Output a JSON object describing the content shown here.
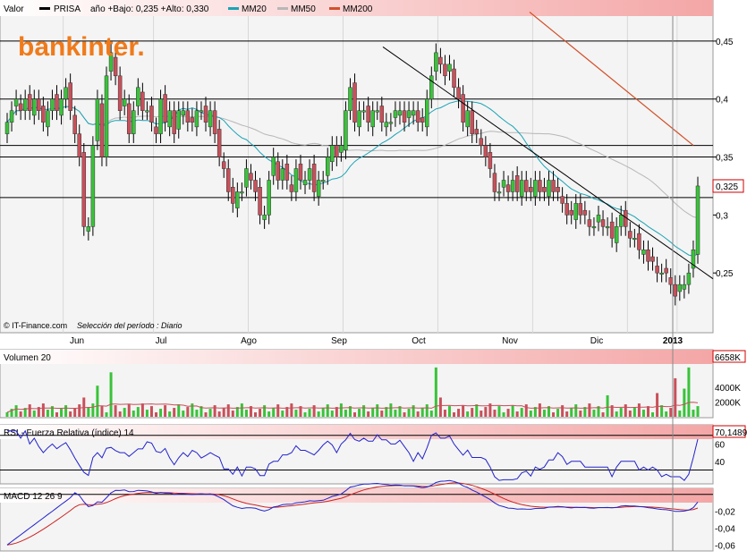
{
  "header": {
    "valor_label": "Valor",
    "ticker": "PRISA",
    "stats": "año +Bajo: 0,235 +Alto: 0,330",
    "legend": [
      {
        "name": "MM20",
        "color": "#1aa3b5"
      },
      {
        "name": "MM50",
        "color": "#b7b7b7"
      },
      {
        "name": "MM200",
        "color": "#d2502a"
      }
    ]
  },
  "brand": {
    "logo_text": "bankinter.",
    "color": "#f07a1a"
  },
  "credits": {
    "source": "© IT-Finance.com",
    "period_label": "Selección del período : Diario"
  },
  "colors": {
    "up": "#39c33a",
    "down": "#c8505a",
    "panel_bg": "#f4f4f4",
    "header_bg_start": "#ffffff",
    "header_bg_end": "#f2a8a8",
    "rsi": "#2222cc",
    "macd": "#2222cc",
    "signal": "#cc2222"
  },
  "chart_data": [
    {
      "id": "price",
      "type": "candlestick",
      "ylim": [
        0.2,
        0.47
      ],
      "yticks": [
        {
          "v": 0.45,
          "label": "0,45"
        },
        {
          "v": 0.4,
          "label": "0,4"
        },
        {
          "v": 0.35,
          "label": "0,35"
        },
        {
          "v": 0.3,
          "label": "0,3"
        },
        {
          "v": 0.25,
          "label": "0,25"
        }
      ],
      "last_value_label": "0,325",
      "last_value": 0.325,
      "xtick_labels": [
        "Jun",
        "Jul",
        "Ago",
        "Sep",
        "Oct",
        "Nov",
        "Dic",
        "2013"
      ],
      "horizontal_levels": [
        0.45,
        0.4,
        0.36,
        0.35,
        0.315
      ],
      "trendline": {
        "from": [
          0.445
        ],
        "to": [
          0.25
        ],
        "description": ""
      },
      "close": [
        0.38,
        0.39,
        0.4,
        0.39,
        0.4,
        0.39,
        0.4,
        0.39,
        0.38,
        0.39,
        0.4,
        0.39,
        0.4,
        0.41,
        0.39,
        0.37,
        0.35,
        0.29,
        0.29,
        0.36,
        0.4,
        0.35,
        0.42,
        0.44,
        0.42,
        0.39,
        0.4,
        0.37,
        0.39,
        0.41,
        0.39,
        0.39,
        0.38,
        0.37,
        0.4,
        0.38,
        0.39,
        0.37,
        0.39,
        0.39,
        0.38,
        0.38,
        0.39,
        0.39,
        0.38,
        0.39,
        0.37,
        0.35,
        0.34,
        0.32,
        0.31,
        0.32,
        0.32,
        0.34,
        0.33,
        0.32,
        0.3,
        0.3,
        0.33,
        0.35,
        0.33,
        0.34,
        0.33,
        0.32,
        0.34,
        0.33,
        0.33,
        0.34,
        0.32,
        0.33,
        0.33,
        0.35,
        0.36,
        0.35,
        0.36,
        0.39,
        0.41,
        0.38,
        0.39,
        0.39,
        0.38,
        0.39,
        0.39,
        0.38,
        0.38,
        0.38,
        0.39,
        0.39,
        0.38,
        0.39,
        0.39,
        0.38,
        0.38,
        0.4,
        0.42,
        0.44,
        0.43,
        0.42,
        0.43,
        0.41,
        0.4,
        0.38,
        0.39,
        0.37,
        0.37,
        0.36,
        0.35,
        0.34,
        0.32,
        0.32,
        0.33,
        0.32,
        0.33,
        0.32,
        0.33,
        0.32,
        0.32,
        0.33,
        0.32,
        0.32,
        0.33,
        0.32,
        0.32,
        0.31,
        0.3,
        0.3,
        0.31,
        0.3,
        0.3,
        0.29,
        0.29,
        0.3,
        0.29,
        0.29,
        0.28,
        0.29,
        0.3,
        0.29,
        0.28,
        0.28,
        0.27,
        0.27,
        0.26,
        0.26,
        0.25,
        0.25,
        0.25,
        0.24,
        0.23,
        0.24,
        0.24,
        0.25,
        0.27,
        0.325
      ],
      "volume_max_label": "6658K"
    },
    {
      "id": "volume",
      "type": "bar",
      "title": "Volumen 20",
      "ylim": [
        0,
        7000
      ],
      "yticks": [
        {
          "v": 4000,
          "label": "4000K"
        },
        {
          "v": 2000,
          "label": "2000K"
        }
      ],
      "last_value_label": "6658K"
    },
    {
      "id": "rsi",
      "type": "line",
      "title": "RSI - Fuerza Relativa (índice) 14",
      "ylim": [
        15,
        80
      ],
      "yticks": [
        {
          "v": 60,
          "label": "60"
        },
        {
          "v": 40,
          "label": "40"
        }
      ],
      "last_value_label": "70,1489",
      "levels": [
        70,
        30
      ]
    },
    {
      "id": "macd",
      "type": "line",
      "title": "MACD 12 26 9",
      "ylim": [
        -0.065,
        0.005
      ],
      "yticks": [
        {
          "v": -0.02,
          "label": "-0,02"
        },
        {
          "v": -0.04,
          "label": "-0,04"
        },
        {
          "v": -0.06,
          "label": "-0,06"
        }
      ]
    }
  ]
}
